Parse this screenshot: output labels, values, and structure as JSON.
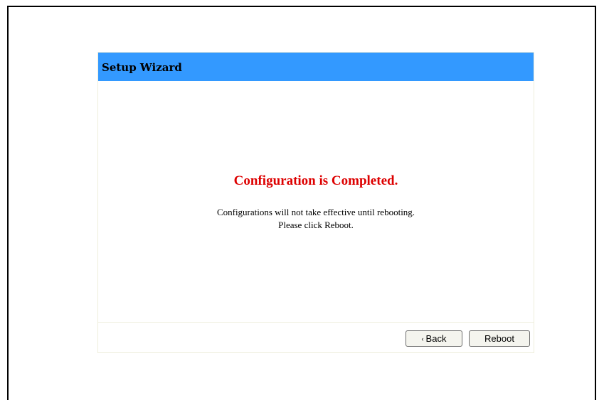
{
  "wizard": {
    "title": "Setup Wizard"
  },
  "content": {
    "headline": "Configuration is Completed.",
    "message_line1": "Configurations will not take effective until rebooting.",
    "message_line2": "Please click Reboot."
  },
  "buttons": {
    "back_icon": "‹",
    "back_label": "Back",
    "reboot_label": "Reboot"
  },
  "colors": {
    "header_bg": "#3399ff",
    "headline": "#dd0000"
  }
}
